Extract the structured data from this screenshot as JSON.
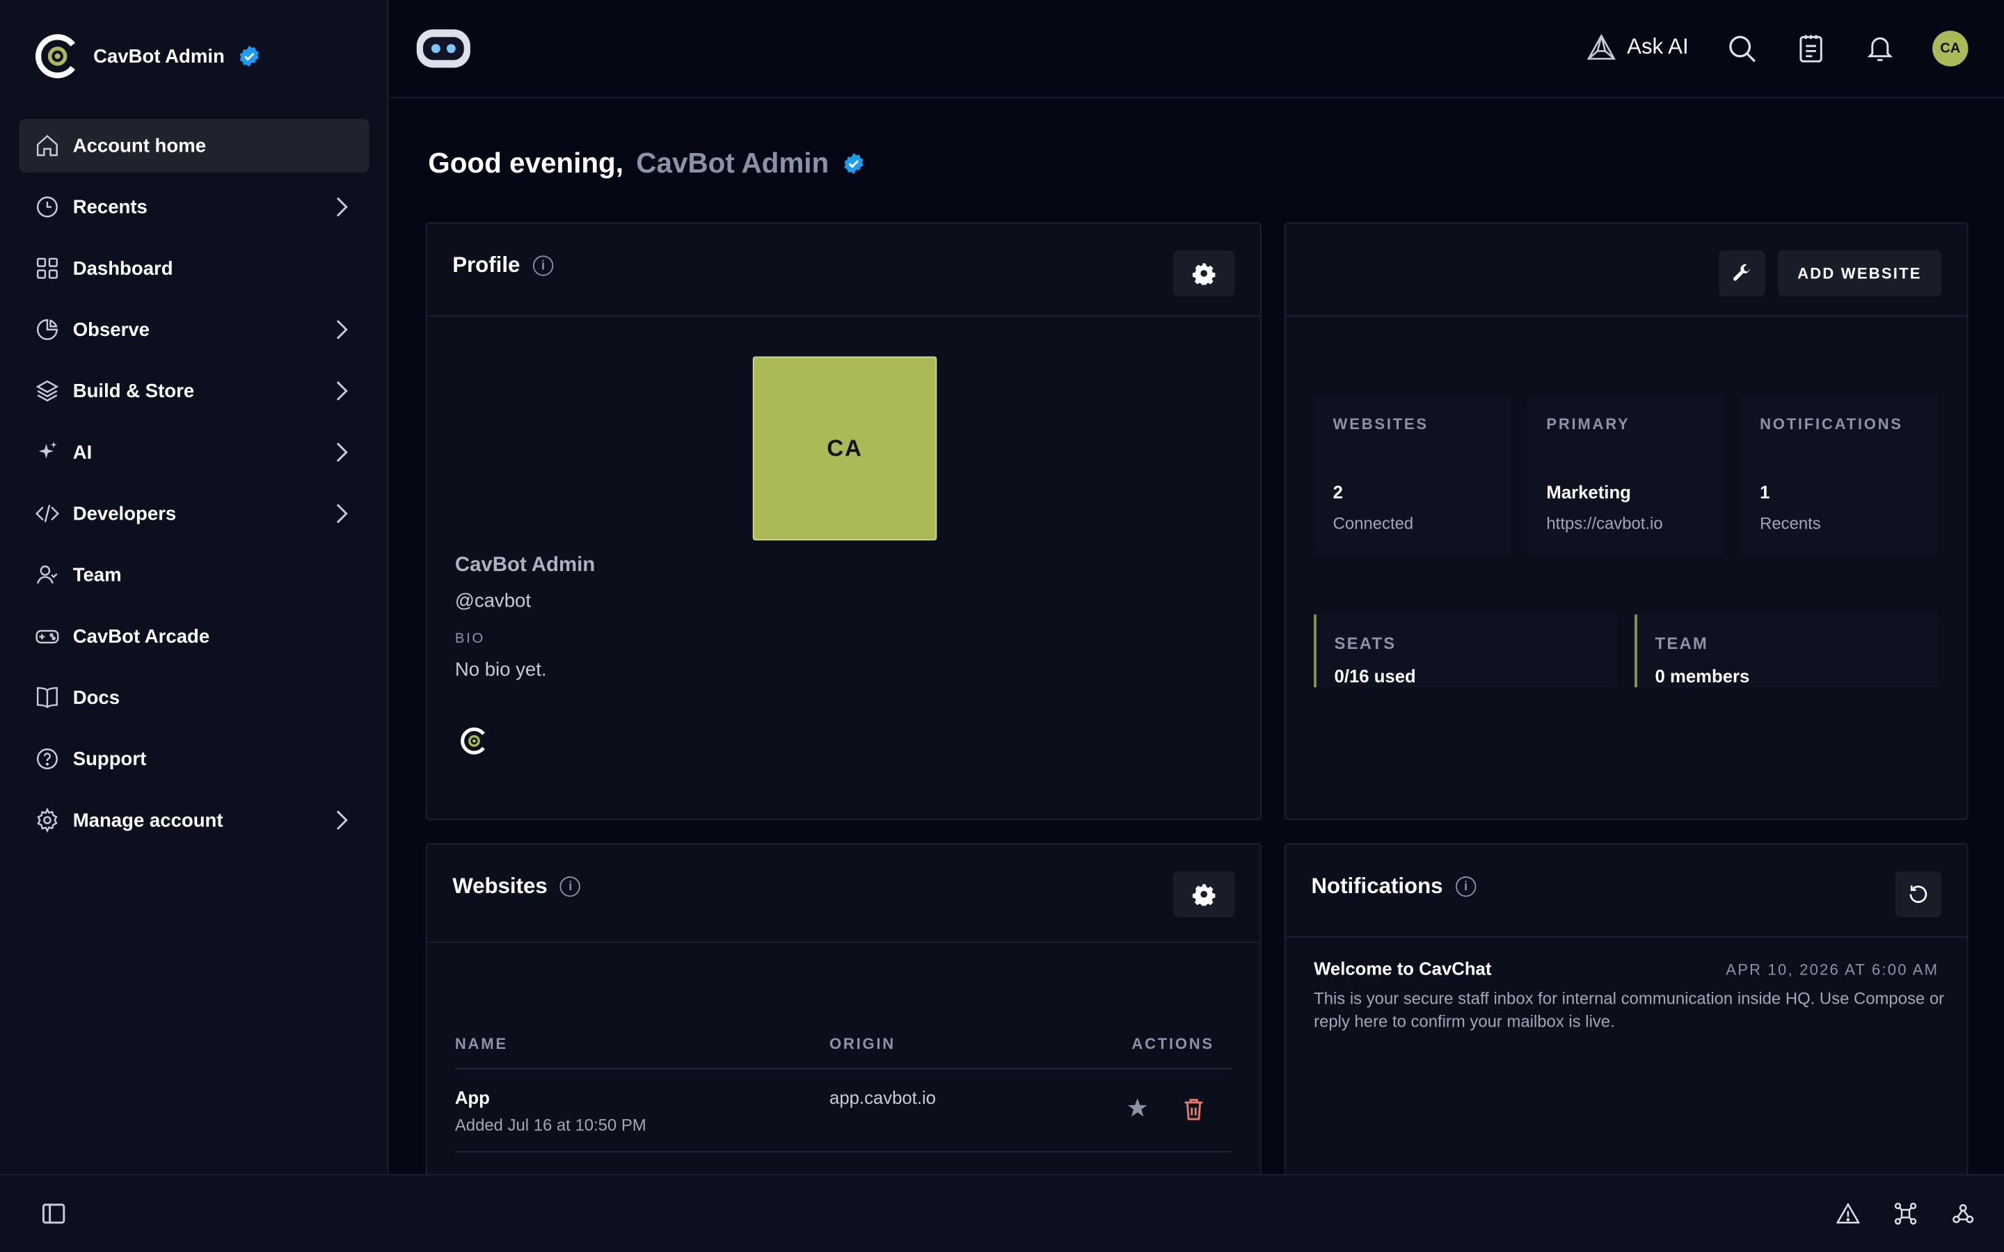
{
  "brand": {
    "name": "CavBot Admin"
  },
  "sidebar": {
    "items": [
      {
        "label": "Account home"
      },
      {
        "label": "Recents"
      },
      {
        "label": "Dashboard"
      },
      {
        "label": "Observe"
      },
      {
        "label": "Build & Store"
      },
      {
        "label": "AI"
      },
      {
        "label": "Developers"
      },
      {
        "label": "Team"
      },
      {
        "label": "CavBot Arcade"
      },
      {
        "label": "Docs"
      },
      {
        "label": "Support"
      },
      {
        "label": "Manage account"
      }
    ]
  },
  "topbar": {
    "ask_ai": "Ask AI",
    "avatar_initials": "CA"
  },
  "greeting": {
    "prefix": "Good evening,",
    "name": "CavBot Admin"
  },
  "profile": {
    "title": "Profile",
    "initials": "CA",
    "name": "CavBot Admin",
    "handle": "@cavbot",
    "bio_label": "BIO",
    "bio": "No bio yet."
  },
  "overview": {
    "add_website": "ADD WEBSITE",
    "stats": [
      {
        "label": "WEBSITES",
        "value": "2",
        "sub": "Connected"
      },
      {
        "label": "PRIMARY",
        "value": "Marketing",
        "sub": "https://cavbot.io"
      },
      {
        "label": "NOTIFICATIONS",
        "value": "1",
        "sub": "Recents"
      }
    ],
    "seats": {
      "label": "SEATS",
      "value": "0/16 used"
    },
    "team": {
      "label": "TEAM",
      "value": "0 members"
    }
  },
  "websites": {
    "title": "Websites",
    "columns": [
      "NAME",
      "ORIGIN",
      "ACTIONS"
    ],
    "rows": [
      {
        "name": "App",
        "added": "Added Jul 16 at 10:50 PM",
        "origin": "app.cavbot.io"
      }
    ]
  },
  "notifications": {
    "title": "Notifications",
    "items": [
      {
        "title": "Welcome to CavChat",
        "date": "APR 10, 2026 AT 6:00 AM",
        "body": "This is your secure staff inbox for internal communication inside HQ. Use Compose or reply here to confirm your mailbox is live."
      }
    ]
  },
  "colors": {
    "accent": "#abba56",
    "background": "#050814",
    "panel": "#0b0f1c",
    "verified": "#1d9bf0",
    "danger": "#e07a6a"
  }
}
